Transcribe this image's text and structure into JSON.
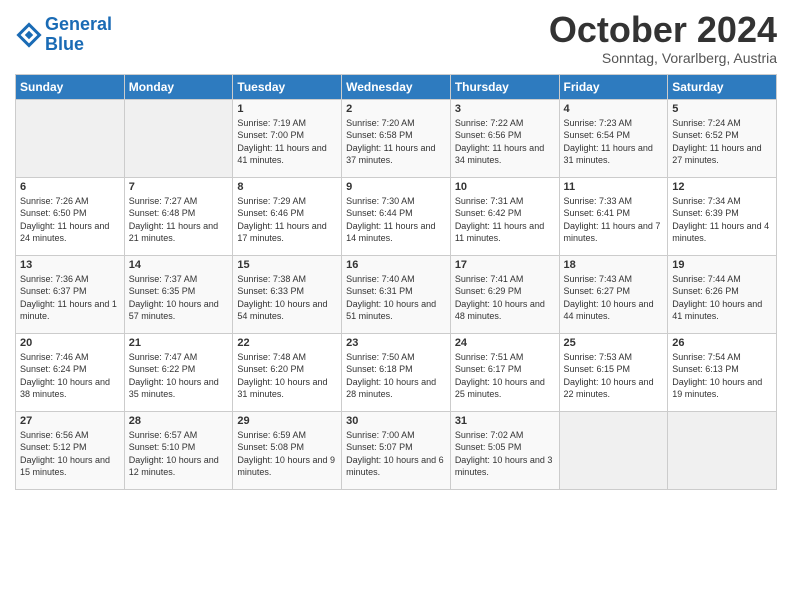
{
  "header": {
    "logo_line1": "General",
    "logo_line2": "Blue",
    "month_title": "October 2024",
    "location": "Sonntag, Vorarlberg, Austria"
  },
  "weekdays": [
    "Sunday",
    "Monday",
    "Tuesday",
    "Wednesday",
    "Thursday",
    "Friday",
    "Saturday"
  ],
  "weeks": [
    [
      {
        "day": "",
        "content": ""
      },
      {
        "day": "",
        "content": ""
      },
      {
        "day": "1",
        "content": "Sunrise: 7:19 AM\nSunset: 7:00 PM\nDaylight: 11 hours and 41 minutes."
      },
      {
        "day": "2",
        "content": "Sunrise: 7:20 AM\nSunset: 6:58 PM\nDaylight: 11 hours and 37 minutes."
      },
      {
        "day": "3",
        "content": "Sunrise: 7:22 AM\nSunset: 6:56 PM\nDaylight: 11 hours and 34 minutes."
      },
      {
        "day": "4",
        "content": "Sunrise: 7:23 AM\nSunset: 6:54 PM\nDaylight: 11 hours and 31 minutes."
      },
      {
        "day": "5",
        "content": "Sunrise: 7:24 AM\nSunset: 6:52 PM\nDaylight: 11 hours and 27 minutes."
      }
    ],
    [
      {
        "day": "6",
        "content": "Sunrise: 7:26 AM\nSunset: 6:50 PM\nDaylight: 11 hours and 24 minutes."
      },
      {
        "day": "7",
        "content": "Sunrise: 7:27 AM\nSunset: 6:48 PM\nDaylight: 11 hours and 21 minutes."
      },
      {
        "day": "8",
        "content": "Sunrise: 7:29 AM\nSunset: 6:46 PM\nDaylight: 11 hours and 17 minutes."
      },
      {
        "day": "9",
        "content": "Sunrise: 7:30 AM\nSunset: 6:44 PM\nDaylight: 11 hours and 14 minutes."
      },
      {
        "day": "10",
        "content": "Sunrise: 7:31 AM\nSunset: 6:42 PM\nDaylight: 11 hours and 11 minutes."
      },
      {
        "day": "11",
        "content": "Sunrise: 7:33 AM\nSunset: 6:41 PM\nDaylight: 11 hours and 7 minutes."
      },
      {
        "day": "12",
        "content": "Sunrise: 7:34 AM\nSunset: 6:39 PM\nDaylight: 11 hours and 4 minutes."
      }
    ],
    [
      {
        "day": "13",
        "content": "Sunrise: 7:36 AM\nSunset: 6:37 PM\nDaylight: 11 hours and 1 minute."
      },
      {
        "day": "14",
        "content": "Sunrise: 7:37 AM\nSunset: 6:35 PM\nDaylight: 10 hours and 57 minutes."
      },
      {
        "day": "15",
        "content": "Sunrise: 7:38 AM\nSunset: 6:33 PM\nDaylight: 10 hours and 54 minutes."
      },
      {
        "day": "16",
        "content": "Sunrise: 7:40 AM\nSunset: 6:31 PM\nDaylight: 10 hours and 51 minutes."
      },
      {
        "day": "17",
        "content": "Sunrise: 7:41 AM\nSunset: 6:29 PM\nDaylight: 10 hours and 48 minutes."
      },
      {
        "day": "18",
        "content": "Sunrise: 7:43 AM\nSunset: 6:27 PM\nDaylight: 10 hours and 44 minutes."
      },
      {
        "day": "19",
        "content": "Sunrise: 7:44 AM\nSunset: 6:26 PM\nDaylight: 10 hours and 41 minutes."
      }
    ],
    [
      {
        "day": "20",
        "content": "Sunrise: 7:46 AM\nSunset: 6:24 PM\nDaylight: 10 hours and 38 minutes."
      },
      {
        "day": "21",
        "content": "Sunrise: 7:47 AM\nSunset: 6:22 PM\nDaylight: 10 hours and 35 minutes."
      },
      {
        "day": "22",
        "content": "Sunrise: 7:48 AM\nSunset: 6:20 PM\nDaylight: 10 hours and 31 minutes."
      },
      {
        "day": "23",
        "content": "Sunrise: 7:50 AM\nSunset: 6:18 PM\nDaylight: 10 hours and 28 minutes."
      },
      {
        "day": "24",
        "content": "Sunrise: 7:51 AM\nSunset: 6:17 PM\nDaylight: 10 hours and 25 minutes."
      },
      {
        "day": "25",
        "content": "Sunrise: 7:53 AM\nSunset: 6:15 PM\nDaylight: 10 hours and 22 minutes."
      },
      {
        "day": "26",
        "content": "Sunrise: 7:54 AM\nSunset: 6:13 PM\nDaylight: 10 hours and 19 minutes."
      }
    ],
    [
      {
        "day": "27",
        "content": "Sunrise: 6:56 AM\nSunset: 5:12 PM\nDaylight: 10 hours and 15 minutes."
      },
      {
        "day": "28",
        "content": "Sunrise: 6:57 AM\nSunset: 5:10 PM\nDaylight: 10 hours and 12 minutes."
      },
      {
        "day": "29",
        "content": "Sunrise: 6:59 AM\nSunset: 5:08 PM\nDaylight: 10 hours and 9 minutes."
      },
      {
        "day": "30",
        "content": "Sunrise: 7:00 AM\nSunset: 5:07 PM\nDaylight: 10 hours and 6 minutes."
      },
      {
        "day": "31",
        "content": "Sunrise: 7:02 AM\nSunset: 5:05 PM\nDaylight: 10 hours and 3 minutes."
      },
      {
        "day": "",
        "content": ""
      },
      {
        "day": "",
        "content": ""
      }
    ]
  ]
}
